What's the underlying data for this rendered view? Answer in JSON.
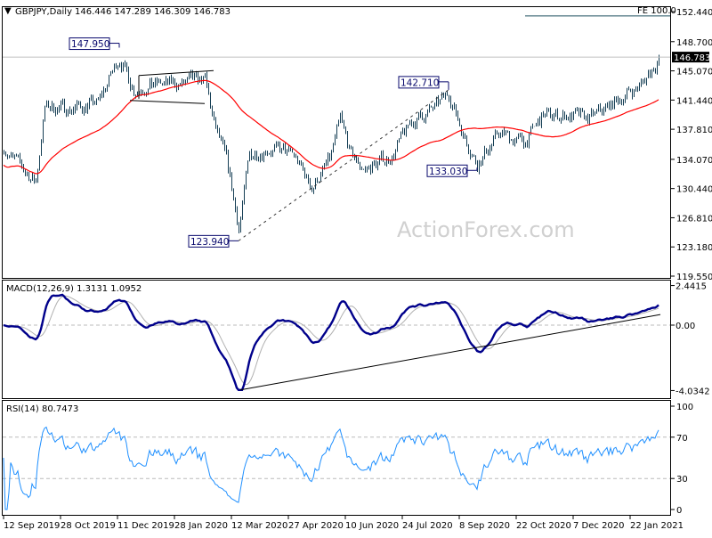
{
  "header": {
    "symbol": "GBPJPY,Daily",
    "ohlc": "146.446 147.289 146.309 146.783"
  },
  "watermark": "ActionForex.com",
  "colors": {
    "bars": "#163f55",
    "ma": "#ff0000",
    "macd": "#00008b",
    "signal": "#b0b0b0",
    "rsi": "#1e8fff",
    "label": "#0a0a6e"
  },
  "chart_data": [
    {
      "type": "ohlc",
      "title": "GBPJPY,Daily",
      "x_unit": "trading day index",
      "close_anchors": [
        {
          "i": 0,
          "close": 135.6
        },
        {
          "i": 6,
          "close": 133.9
        },
        {
          "i": 18,
          "close": 131.2
        },
        {
          "i": 23,
          "close": 140.6
        },
        {
          "i": 38,
          "close": 140.4
        },
        {
          "i": 53,
          "close": 141.1
        },
        {
          "i": 60,
          "close": 144.5
        },
        {
          "i": 65,
          "close": 146.7
        },
        {
          "i": 73,
          "close": 142.8
        },
        {
          "i": 85,
          "close": 143.4
        },
        {
          "i": 98,
          "close": 143.4
        },
        {
          "i": 113,
          "close": 143.9
        },
        {
          "i": 118,
          "close": 138.4
        },
        {
          "i": 125,
          "close": 133.9
        },
        {
          "i": 132,
          "close": 125.5
        },
        {
          "i": 138,
          "close": 134.5
        },
        {
          "i": 148,
          "close": 135.6
        },
        {
          "i": 163,
          "close": 134.5
        },
        {
          "i": 173,
          "close": 130.6
        },
        {
          "i": 183,
          "close": 133.9
        },
        {
          "i": 189,
          "close": 138.9
        },
        {
          "i": 195,
          "close": 134.5
        },
        {
          "i": 203,
          "close": 132.8
        },
        {
          "i": 218,
          "close": 134.5
        },
        {
          "i": 228,
          "close": 138.4
        },
        {
          "i": 243,
          "close": 140.6
        },
        {
          "i": 250,
          "close": 142.3
        },
        {
          "i": 258,
          "close": 137.3
        },
        {
          "i": 266,
          "close": 133.5
        },
        {
          "i": 278,
          "close": 137.3
        },
        {
          "i": 293,
          "close": 136.2
        },
        {
          "i": 303,
          "close": 139.5
        },
        {
          "i": 318,
          "close": 139.5
        },
        {
          "i": 328,
          "close": 139.0
        },
        {
          "i": 343,
          "close": 141.1
        },
        {
          "i": 358,
          "close": 143.4
        },
        {
          "i": 365,
          "close": 145.6
        },
        {
          "i": 368,
          "close": 146.783
        }
      ],
      "ylim": [
        119.55,
        152.44
      ],
      "y_ticks": [
        "152.440",
        "148.700",
        "145.070",
        "141.440",
        "137.810",
        "134.070",
        "130.440",
        "126.810",
        "123.180",
        "119.550"
      ],
      "current_price": "146.783",
      "moving_average": {
        "period": 55,
        "color": "red"
      },
      "fe_level": {
        "label": "FE 100.0",
        "price": 151.9
      },
      "annotations": [
        {
          "text": "147.950",
          "i": 65,
          "price": 147.95
        },
        {
          "text": "142.710",
          "i": 250,
          "price": 142.71
        },
        {
          "text": "133.030",
          "i": 266,
          "price": 133.03
        },
        {
          "text": "123.940",
          "i": 132,
          "price": 123.94
        }
      ],
      "channel": {
        "upper": [
          [
            76,
            144.5
          ],
          [
            118,
            145.1
          ]
        ],
        "lower": [
          [
            71,
            141.4
          ],
          [
            113,
            141.0
          ]
        ]
      },
      "trendline_dashed": [
        [
          132,
          123.94
        ],
        [
          250,
          142.71
        ]
      ]
    },
    {
      "type": "line",
      "title": "MACD(12,26,9) 1.3131 1.0952",
      "series": [
        {
          "name": "MACD",
          "params": [
            12,
            26,
            9
          ]
        },
        {
          "name": "Signal"
        }
      ],
      "ylim": [
        -4.0342,
        2.4415
      ],
      "y_ticks": [
        "2.4415",
        "0.00",
        "-4.0342"
      ],
      "trendline": [
        [
          133,
          -4.0
        ],
        [
          369,
          0.65
        ]
      ]
    },
    {
      "type": "line",
      "title": "RSI(14) 80.7473",
      "series": [
        {
          "name": "RSI",
          "period": 14
        }
      ],
      "ylim": [
        0,
        100
      ],
      "y_ticks": [
        "100",
        "70",
        "30",
        "0"
      ],
      "levels": [
        70,
        30
      ]
    }
  ],
  "x_axis": {
    "labels": [
      "12 Sep 2019",
      "28 Oct 2019",
      "11 Dec 2019",
      "28 Jan 2020",
      "12 Mar 2020",
      "27 Apr 2020",
      "10 Jun 2020",
      "24 Jul 2020",
      "8 Sep 2020",
      "22 Oct 2020",
      "7 Dec 2020",
      "22 Jan 2021"
    ],
    "label_index": [
      0,
      32,
      64,
      96,
      128,
      160,
      192,
      224,
      256,
      288,
      320,
      352
    ]
  }
}
